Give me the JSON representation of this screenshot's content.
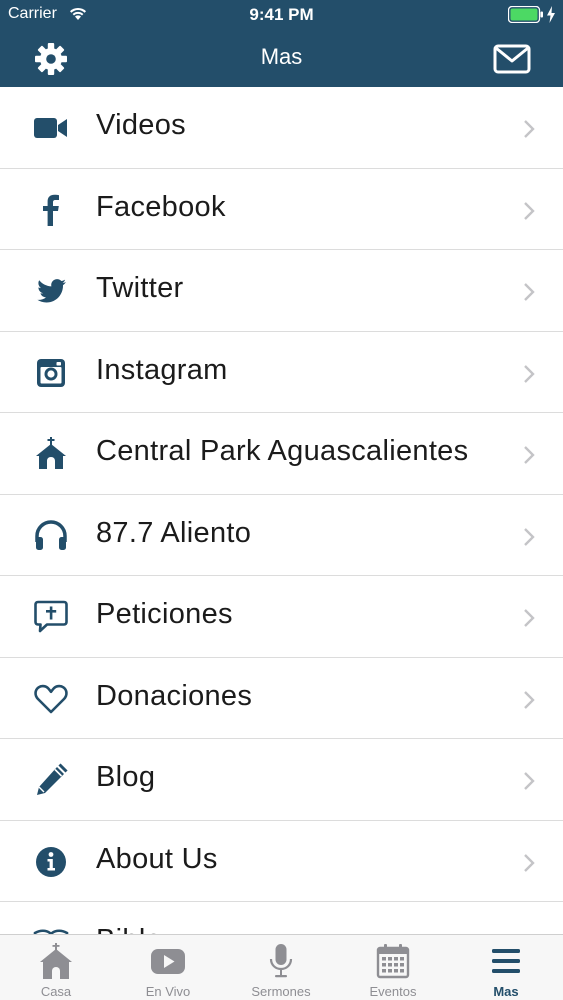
{
  "status_bar": {
    "carrier": "Carrier",
    "time": "9:41 PM"
  },
  "nav": {
    "title": "Mas",
    "left_icon": "gear-icon",
    "right_icon": "mail-icon"
  },
  "colors": {
    "accent": "#234e6a",
    "tab_inactive": "#8e8e93",
    "battery": "#4cd964"
  },
  "menu_items": [
    {
      "label": "Videos",
      "icon": "video-camera-icon"
    },
    {
      "label": "Facebook",
      "icon": "facebook-icon"
    },
    {
      "label": "Twitter",
      "icon": "twitter-icon"
    },
    {
      "label": "Instagram",
      "icon": "instagram-icon"
    },
    {
      "label": "Central Park Aguascalientes",
      "icon": "church-icon"
    },
    {
      "label": "87.7 Aliento",
      "icon": "headphones-icon"
    },
    {
      "label": "Peticiones",
      "icon": "prayer-bubble-icon"
    },
    {
      "label": "Donaciones",
      "icon": "heart-icon"
    },
    {
      "label": "Blog",
      "icon": "pencil-icon"
    },
    {
      "label": "About Us",
      "icon": "info-icon"
    },
    {
      "label": "Bible",
      "icon": "bible-icon"
    }
  ],
  "tabs": [
    {
      "label": "Casa",
      "icon": "church-home-icon",
      "active": false
    },
    {
      "label": "En Vivo",
      "icon": "play-icon",
      "active": false
    },
    {
      "label": "Sermones",
      "icon": "microphone-icon",
      "active": false
    },
    {
      "label": "Eventos",
      "icon": "calendar-icon",
      "active": false
    },
    {
      "label": "Mas",
      "icon": "menu-icon",
      "active": true
    }
  ]
}
